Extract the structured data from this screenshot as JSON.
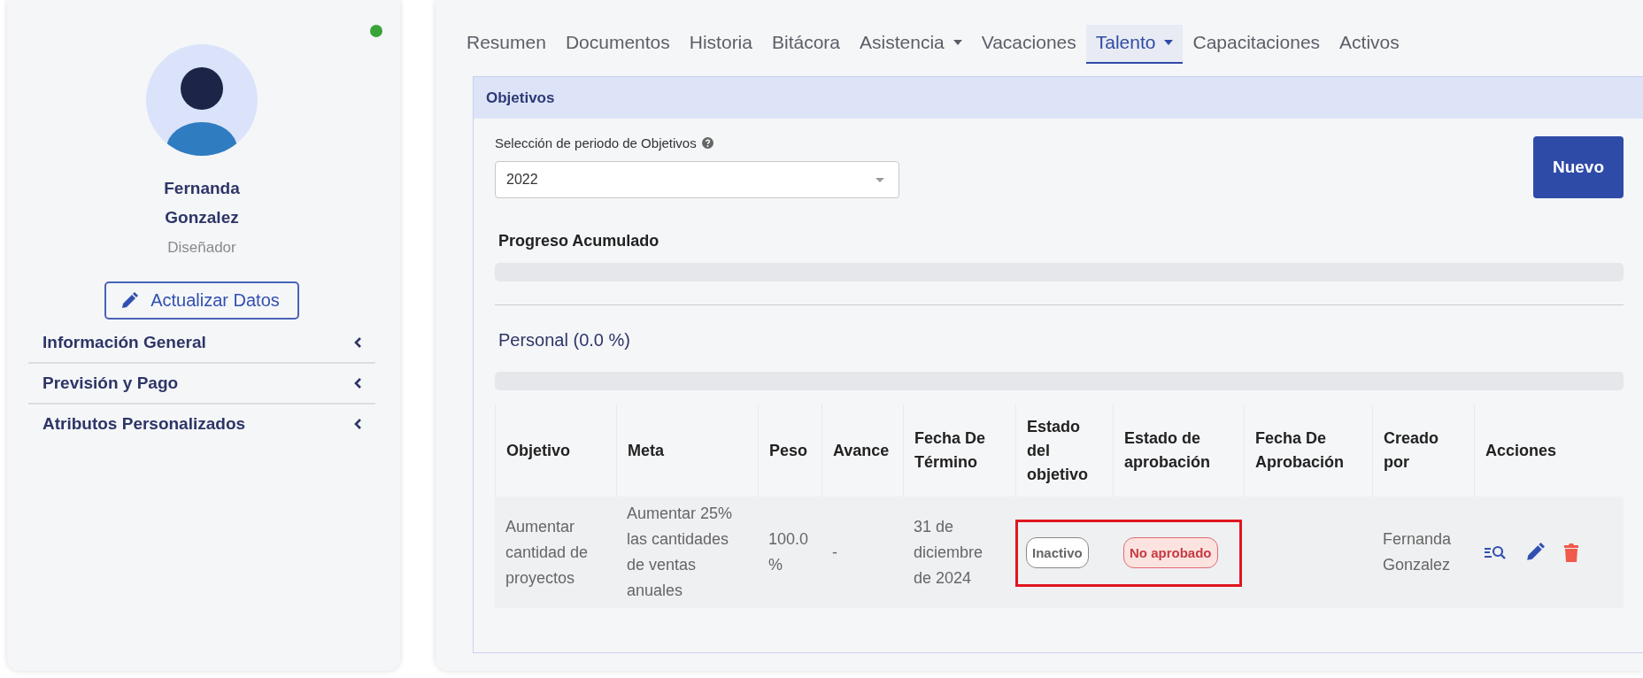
{
  "sidebar": {
    "online": true,
    "profile": {
      "name": "Fernanda Gonzalez",
      "role": "Diseñador"
    },
    "update_button": "Actualizar Datos",
    "sections": [
      {
        "label": "Información General",
        "expanded": false
      },
      {
        "label": "Previsión y Pago",
        "expanded": false
      },
      {
        "label": "Atributos Personalizados",
        "expanded": false
      }
    ]
  },
  "tabs": [
    {
      "label": "Resumen",
      "selected": false,
      "dropdown": false
    },
    {
      "label": "Documentos",
      "selected": false,
      "dropdown": false
    },
    {
      "label": "Historia",
      "selected": false,
      "dropdown": false
    },
    {
      "label": "Bitácora",
      "selected": false,
      "dropdown": false
    },
    {
      "label": "Asistencia",
      "selected": false,
      "dropdown": true
    },
    {
      "label": "Vacaciones",
      "selected": false,
      "dropdown": false
    },
    {
      "label": "Talento",
      "selected": true,
      "dropdown": true
    },
    {
      "label": "Capacitaciones",
      "selected": false,
      "dropdown": false
    },
    {
      "label": "Activos",
      "selected": false,
      "dropdown": false
    }
  ],
  "panel": {
    "title": "Objetivos",
    "period": {
      "label": "Selección de periodo de Objetivos",
      "value": "2022"
    },
    "new_button": "Nuevo",
    "cumulative": {
      "label": "Progreso Acumulado",
      "level": 0
    },
    "personal": {
      "label": "Personal (0.0 %)",
      "level": 0
    },
    "table": {
      "columns": [
        "Objetivo",
        "Meta",
        "Peso",
        "Avance",
        "Fecha De Término",
        "Estado del objetivo",
        "Estado de aprobación",
        "Fecha De Aprobación",
        "Creado por",
        "Acciones"
      ],
      "rows": [
        {
          "cells": [
            {
              "kind": "text",
              "text": "Aumentar cantidad de proyectos",
              "highlighted": false
            },
            {
              "kind": "text",
              "text": "Aumentar 25% las cantidades de ventas anuales",
              "highlighted": false
            },
            {
              "kind": "text",
              "text": "100.0 %",
              "highlighted": false
            },
            {
              "kind": "text",
              "text": "-",
              "highlighted": false
            },
            {
              "kind": "text",
              "text": "31 de diciembre de 2024",
              "highlighted": false
            },
            {
              "kind": "tag",
              "text": "Inactivo",
              "highlighted": true
            },
            {
              "kind": "alert",
              "text": "No aprobado",
              "highlighted": true
            },
            {
              "kind": "empty",
              "highlighted": false
            },
            {
              "kind": "text",
              "text": "Fernanda Gonzalez",
              "highlighted": false
            },
            {
              "kind": "actions",
              "highlighted": false
            }
          ]
        }
      ]
    }
  }
}
